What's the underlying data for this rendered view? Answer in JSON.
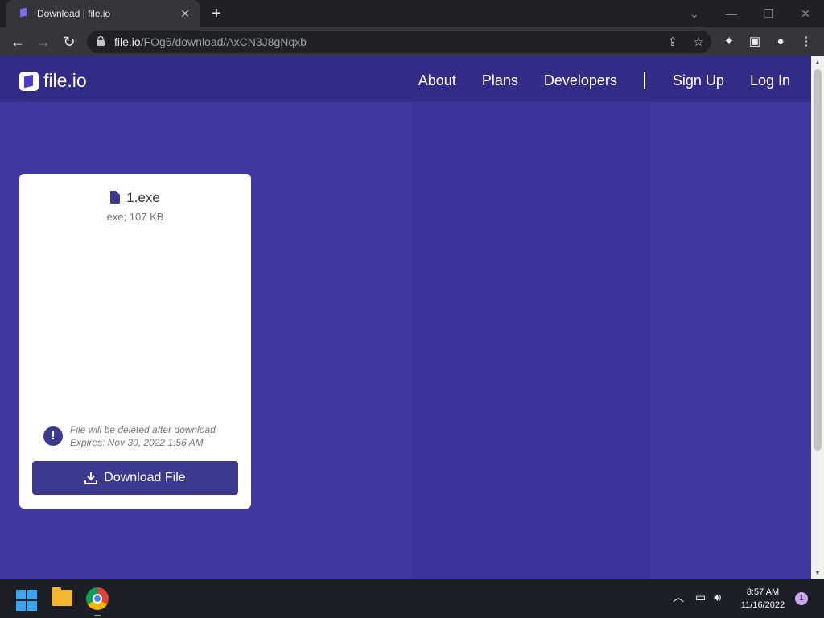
{
  "browser": {
    "tab_title": "Download | file.io",
    "url_host": "file.io",
    "url_path": "/FOg5/download/AxCN3J8gNqxb"
  },
  "header": {
    "logo_text": "file.io",
    "nav": {
      "about": "About",
      "plans": "Plans",
      "developers": "Developers",
      "signup": "Sign Up",
      "login": "Log In"
    }
  },
  "file": {
    "name": "1.exe",
    "meta": "exe; 107 KB",
    "notice_line1": "File will be deleted after download",
    "notice_line2": "Expires: Nov 30, 2022 1:56 AM",
    "download_label": "Download File"
  },
  "taskbar": {
    "time": "8:57 AM",
    "date": "11/16/2022",
    "notification_count": "1"
  }
}
